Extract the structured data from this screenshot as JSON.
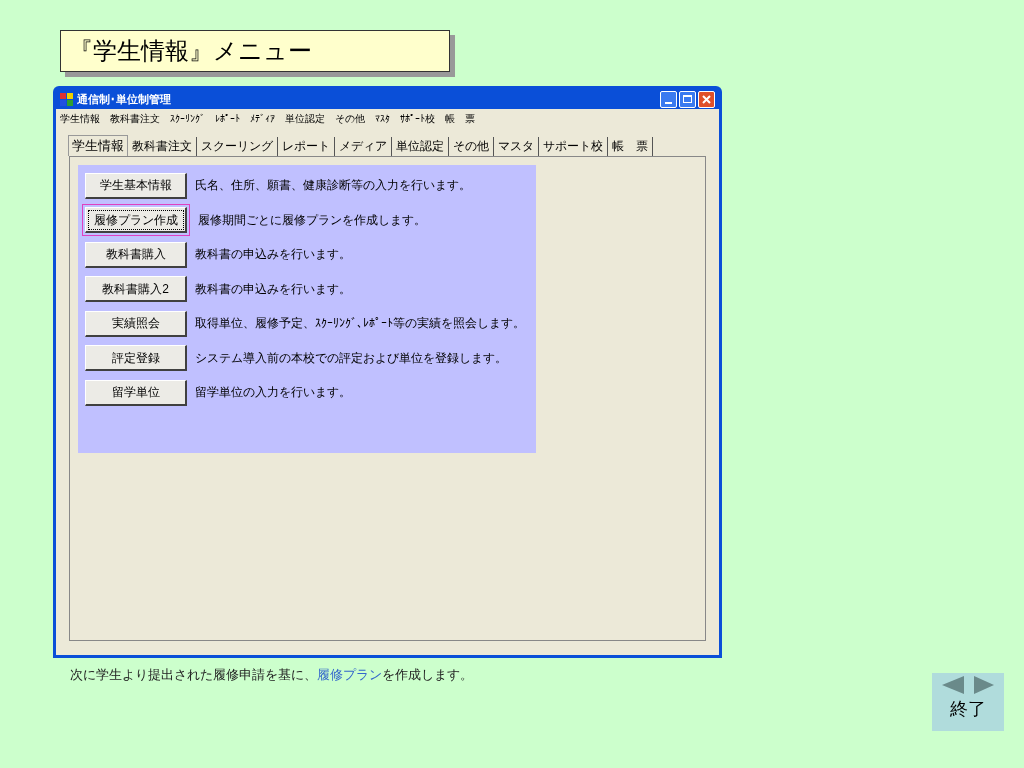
{
  "slide_title": "『学生情報』メニュー",
  "window": {
    "title": "通信制･単位制管理"
  },
  "menu_bar": [
    "学生情報",
    "教科書注文",
    "ｽｸｰﾘﾝｸﾞ",
    "ﾚﾎﾟｰﾄ",
    "ﾒﾃﾞｨｱ",
    "単位認定",
    "その他",
    "ﾏｽﾀ",
    "ｻﾎﾟｰﾄ校",
    "帳　票"
  ],
  "tabs": [
    {
      "label": "学生情報",
      "selected": true
    },
    {
      "label": "教科書注文",
      "selected": false
    },
    {
      "label": "スクーリング",
      "selected": false
    },
    {
      "label": "レポート",
      "selected": false
    },
    {
      "label": "メディア",
      "selected": false
    },
    {
      "label": "単位認定",
      "selected": false
    },
    {
      "label": "その他",
      "selected": false
    },
    {
      "label": "マスタ",
      "selected": false
    },
    {
      "label": "サポート校",
      "selected": false
    },
    {
      "label": "帳　票",
      "selected": false
    }
  ],
  "actions": [
    {
      "button": "学生基本情報",
      "description": "氏名、住所、願書、健康診断等の入力を行います。",
      "highlighted": false
    },
    {
      "button": "履修プラン作成",
      "description": "履修期間ごとに履修プランを作成します。",
      "highlighted": true
    },
    {
      "button": "教科書購入",
      "description": "教科書の申込みを行います。",
      "highlighted": false
    },
    {
      "button": "教科書購入2",
      "description": "教科書の申込みを行います。",
      "highlighted": false
    },
    {
      "button": "実績照会",
      "description": "取得単位、履修予定、ｽｸｰﾘﾝｸﾞ､ﾚﾎﾟｰﾄ等の実績を照会します。",
      "highlighted": false
    },
    {
      "button": "評定登録",
      "description": "システム導入前の本校での評定および単位を登録します。",
      "highlighted": false
    },
    {
      "button": "留学単位",
      "description": "留学単位の入力を行います。",
      "highlighted": false
    }
  ],
  "caption": {
    "before": "次に学生より提出された履修申請を基に、",
    "link": "履修プラン",
    "after": "を作成します。"
  },
  "nav": {
    "exit": "終了"
  }
}
